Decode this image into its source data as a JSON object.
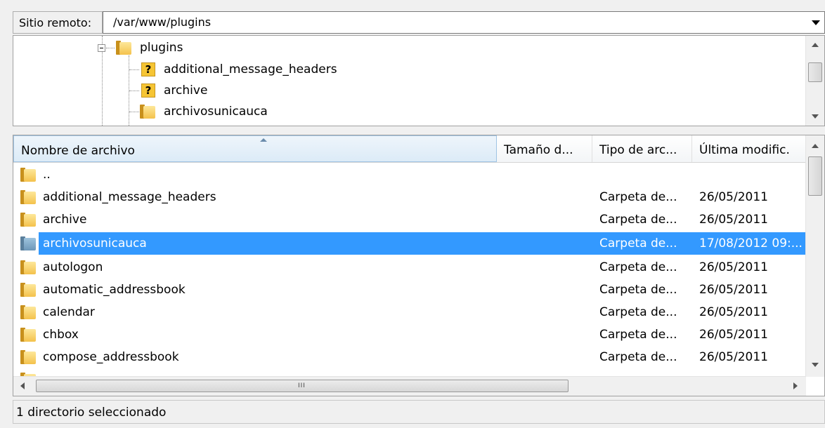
{
  "remote": {
    "label": "Sitio remoto:",
    "path": "/var/www/plugins"
  },
  "tree": {
    "parent": "plugins",
    "children": [
      "additional_message_headers",
      "archive",
      "archivosunicauca"
    ]
  },
  "columns": {
    "name": "Nombre de archivo",
    "size": "Tamaño d...",
    "type": "Tipo de arc...",
    "modified": "Última modific."
  },
  "files": [
    {
      "name": "..",
      "type": "",
      "date": ""
    },
    {
      "name": "additional_message_headers",
      "type": "Carpeta de...",
      "date": "26/05/2011"
    },
    {
      "name": "archive",
      "type": "Carpeta de...",
      "date": "26/05/2011"
    },
    {
      "name": "archivosunicauca",
      "type": "Carpeta de...",
      "date": "17/08/2012 09:..."
    },
    {
      "name": "autologon",
      "type": "Carpeta de...",
      "date": "26/05/2011"
    },
    {
      "name": "automatic_addressbook",
      "type": "Carpeta de...",
      "date": "26/05/2011"
    },
    {
      "name": "calendar",
      "type": "Carpeta de...",
      "date": "26/05/2011"
    },
    {
      "name": "chbox",
      "type": "Carpeta de...",
      "date": "26/05/2011"
    },
    {
      "name": "compose_addressbook",
      "type": "Carpeta de...",
      "date": "26/05/2011"
    }
  ],
  "selected_file": "archivosunicauca",
  "hscroll_grip": "III",
  "status": "1 directorio seleccionado"
}
